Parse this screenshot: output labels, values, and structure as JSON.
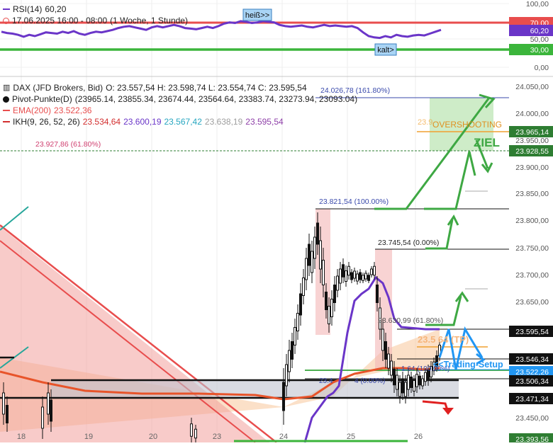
{
  "rsi_panel": {
    "legend": {
      "indicator": "RSI(14)",
      "value": "60,20",
      "timeframe": "17.06.2025 16:00 - 08:00",
      "period": "(1 Woche, 1 Stunde)"
    },
    "axis_labels": [
      "100,00",
      "70,00",
      "60,20",
      "50,00",
      "30,00",
      "0,00"
    ],
    "badges": {
      "hot": "heiß>>",
      "cold": "kalt>"
    },
    "colors": {
      "rsi": "#6a35c8",
      "overbought": "#e84d4d",
      "oversold": "#3bb53b"
    }
  },
  "main_legend": {
    "symbol": "DAX (JFD Brokers, Bid)",
    "ohlc": "O: 23.557,54  H: 23.598,74  L: 23.554,74  C: 23.595,54",
    "pivot_label": "Pivot-Punkte(D)",
    "pivot_values": "(23965.14,  23855.34,  23674.44,  23564.64,  23383.74,  23273.94,  23093.04)",
    "ema_label": "EMA(200)",
    "ema_value": "23.522,36",
    "ikh_label": "IKH(9, 26, 52, 26)",
    "ikh_v1": "23.534,64",
    "ikh_v2": "23.600,19",
    "ikh_v3": "23.567,42",
    "ikh_v4": "23.638,19",
    "ikh_v5": "23.595,54"
  },
  "annotations": {
    "fib_1618": "24.026,78 (161.80%)",
    "fib_618_top": "23.927,86 (61.80%)",
    "fib_100": "23.821,54 (100.00%)",
    "fib_0": "23.745,54 (0.00%)",
    "fib_618_mid": "23.630,99 (61.80%)",
    "fib_100_low": "1.64 (100.00%)",
    "fib_0_low": "23.4",
    "fib_0_low_pct": "4 (0.00%)",
    "overshooting": "OVERSHOOTING",
    "overshoot_num": "23.9",
    "ziel": "ZIEL",
    "tp": "23.5   64 (TP)",
    "trading_setup": "<<Trading-Setup"
  },
  "price_axis": {
    "ticks": [
      "24.050,00",
      "24.000,00",
      "23.950,00",
      "23.900,00",
      "23.850,00",
      "23.800,00",
      "23.750,00",
      "23.700,00",
      "23.650,00",
      "23.450,00"
    ],
    "tags": [
      {
        "text": "23.965,14",
        "bg": "#2e7d32"
      },
      {
        "text": "23.928,55",
        "bg": "#2e7d32"
      },
      {
        "text": "23.595,54",
        "bg": "#111111"
      },
      {
        "text": "23.546,34",
        "bg": "#111111"
      },
      {
        "text": "23.522,26",
        "bg": "#2196f3"
      },
      {
        "text": "23.506,34",
        "bg": "#111111"
      },
      {
        "text": "23.471,34",
        "bg": "#111111"
      },
      {
        "text": "23.393,56",
        "bg": "#2e7d32"
      }
    ]
  },
  "time_axis": [
    "18",
    "19",
    "20",
    "23",
    "24",
    "25",
    "26"
  ],
  "chart_data": {
    "type": "candlestick",
    "symbol": "DAX (JFD Brokers, Bid)",
    "timeframe": "1 Stunde",
    "ylim": [
      23390,
      24060
    ],
    "last": {
      "open": 23557.54,
      "high": 23598.74,
      "low": 23554.74,
      "close": 23595.54
    },
    "pivot_points": [
      23965.14,
      23855.34,
      23674.44,
      23564.64,
      23383.74,
      23273.94,
      23093.04
    ],
    "ema200": 23522.36,
    "ikh": [
      23534.64,
      23600.19,
      23567.42,
      23638.19,
      23595.54
    ],
    "fib_levels": [
      24026.78,
      23927.86,
      23821.54,
      23745.54,
      23630.99
    ],
    "rsi": {
      "value": 60.2,
      "overbought": 70,
      "oversold": 30,
      "series": [
        57,
        55,
        54,
        52,
        49,
        52,
        50,
        53,
        56,
        55,
        54,
        57,
        55,
        58,
        54,
        52,
        55,
        57,
        56,
        58,
        60,
        63,
        65,
        66,
        64,
        62,
        60,
        64,
        66,
        64,
        66,
        68,
        66,
        63,
        62,
        61,
        63,
        65,
        63,
        66,
        70,
        72,
        71,
        74,
        73,
        71,
        72,
        74,
        73,
        72,
        68,
        66,
        65,
        66,
        67,
        65,
        64,
        66,
        68,
        66,
        67,
        66,
        65,
        66,
        63,
        56,
        50,
        48,
        47,
        50,
        48,
        52,
        50,
        49,
        51,
        52,
        51,
        54,
        57,
        60
      ]
    }
  }
}
